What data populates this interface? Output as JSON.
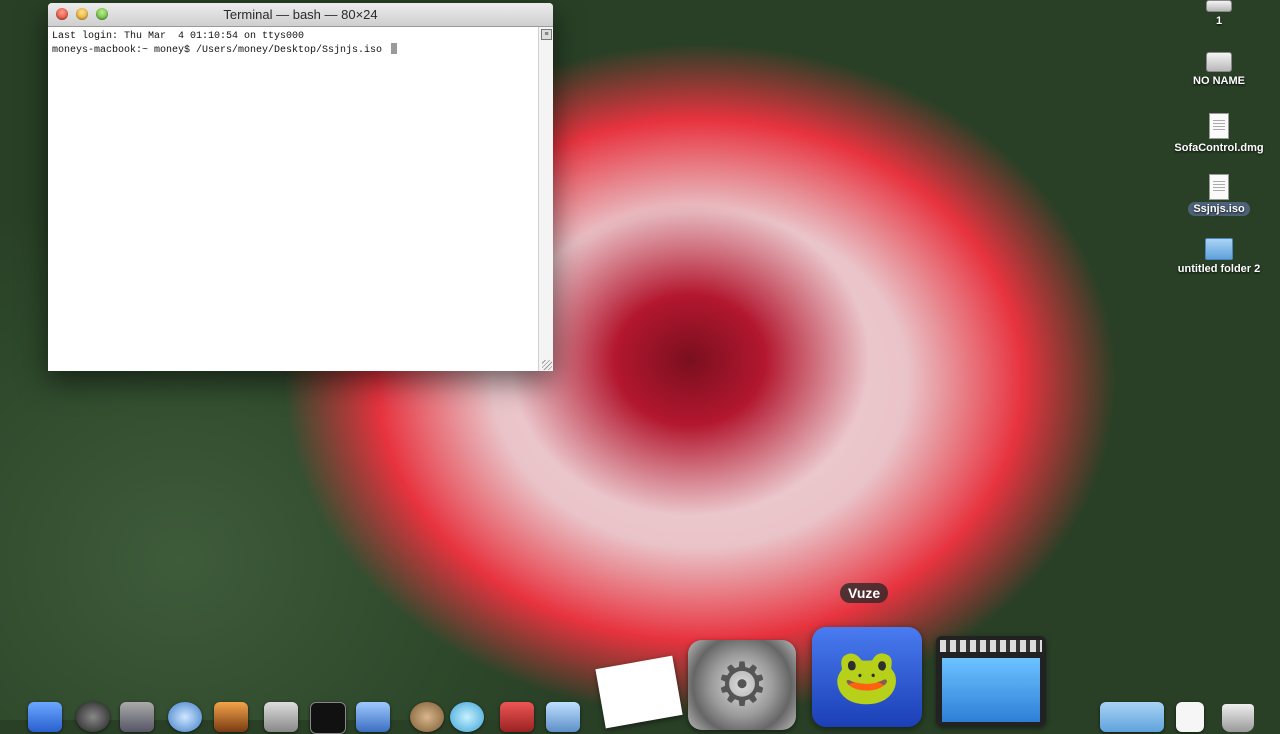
{
  "terminal": {
    "title": "Terminal — bash — 80×24",
    "lines": [
      "Last login: Thu Mar  4 01:10:54 on ttys000",
      "moneys-macbook:~ money$ /Users/money/Desktop/Ssjnjs.iso "
    ]
  },
  "desktop_icons": [
    {
      "label": "1"
    },
    {
      "label": "NO NAME"
    },
    {
      "label": "SofaControl.dmg"
    },
    {
      "label": "Ssjnjs.iso"
    },
    {
      "label": "untitled folder 2"
    }
  ],
  "dock": {
    "tooltip": "Vuze"
  }
}
